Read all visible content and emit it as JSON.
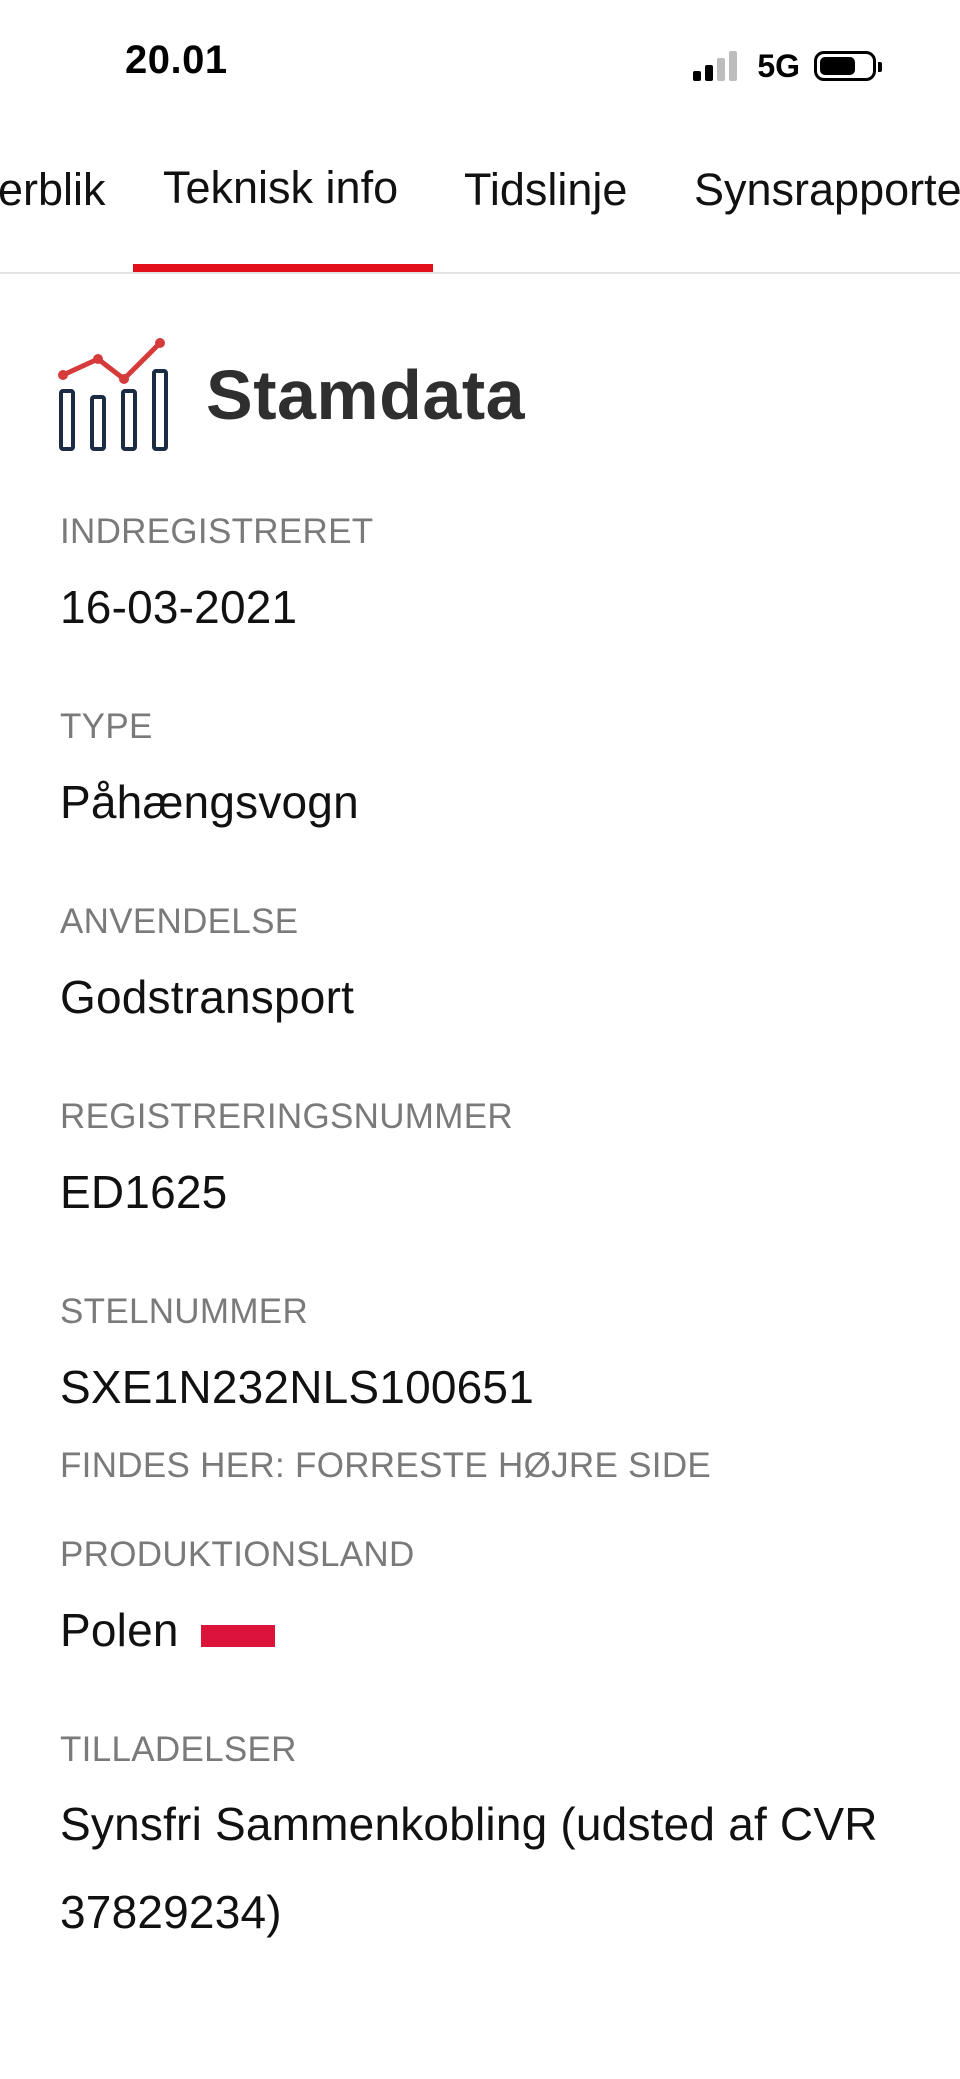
{
  "status_bar": {
    "time": "20.01",
    "network": "5G",
    "signal_bars_active": 2,
    "signal_bars_total": 4,
    "battery_level": 0.7
  },
  "tabs": [
    {
      "label": "Overblik",
      "visible_label": "erblik",
      "active": false
    },
    {
      "label": "Teknisk info",
      "active": true
    },
    {
      "label": "Tidslinje",
      "active": false
    },
    {
      "label": "Synsrapporte",
      "active": false
    }
  ],
  "colors": {
    "accent": "#e3101c",
    "icon_navy": "#1c2b44",
    "icon_red": "#d63b3b",
    "flag_red": "#dc143c",
    "label_gray": "#7a7a7a"
  },
  "section": {
    "title": "Stamdata",
    "icon": "stats-chart-icon"
  },
  "fields": {
    "indregistreret": {
      "label": "INDREGISTRERET",
      "value": "16-03-2021"
    },
    "type": {
      "label": "TYPE",
      "value": "Påhængsvogn"
    },
    "anvendelse": {
      "label": "ANVENDELSE",
      "value": "Godstransport"
    },
    "registreringsnummer": {
      "label": "REGISTRERINGSNUMMER",
      "value": "ED1625"
    },
    "stelnummer": {
      "label": "STELNUMMER",
      "value": "SXE1N232NLS100651",
      "note": "FINDES HER: FORRESTE HØJRE SIDE"
    },
    "produktionsland": {
      "label": "PRODUKTIONSLAND",
      "value": "Polen",
      "flag": "poland-flag-icon"
    },
    "tilladelser": {
      "label": "TILLADELSER",
      "value": "Synsfri Sammenkobling (udsted af CVR 37829234)"
    }
  }
}
